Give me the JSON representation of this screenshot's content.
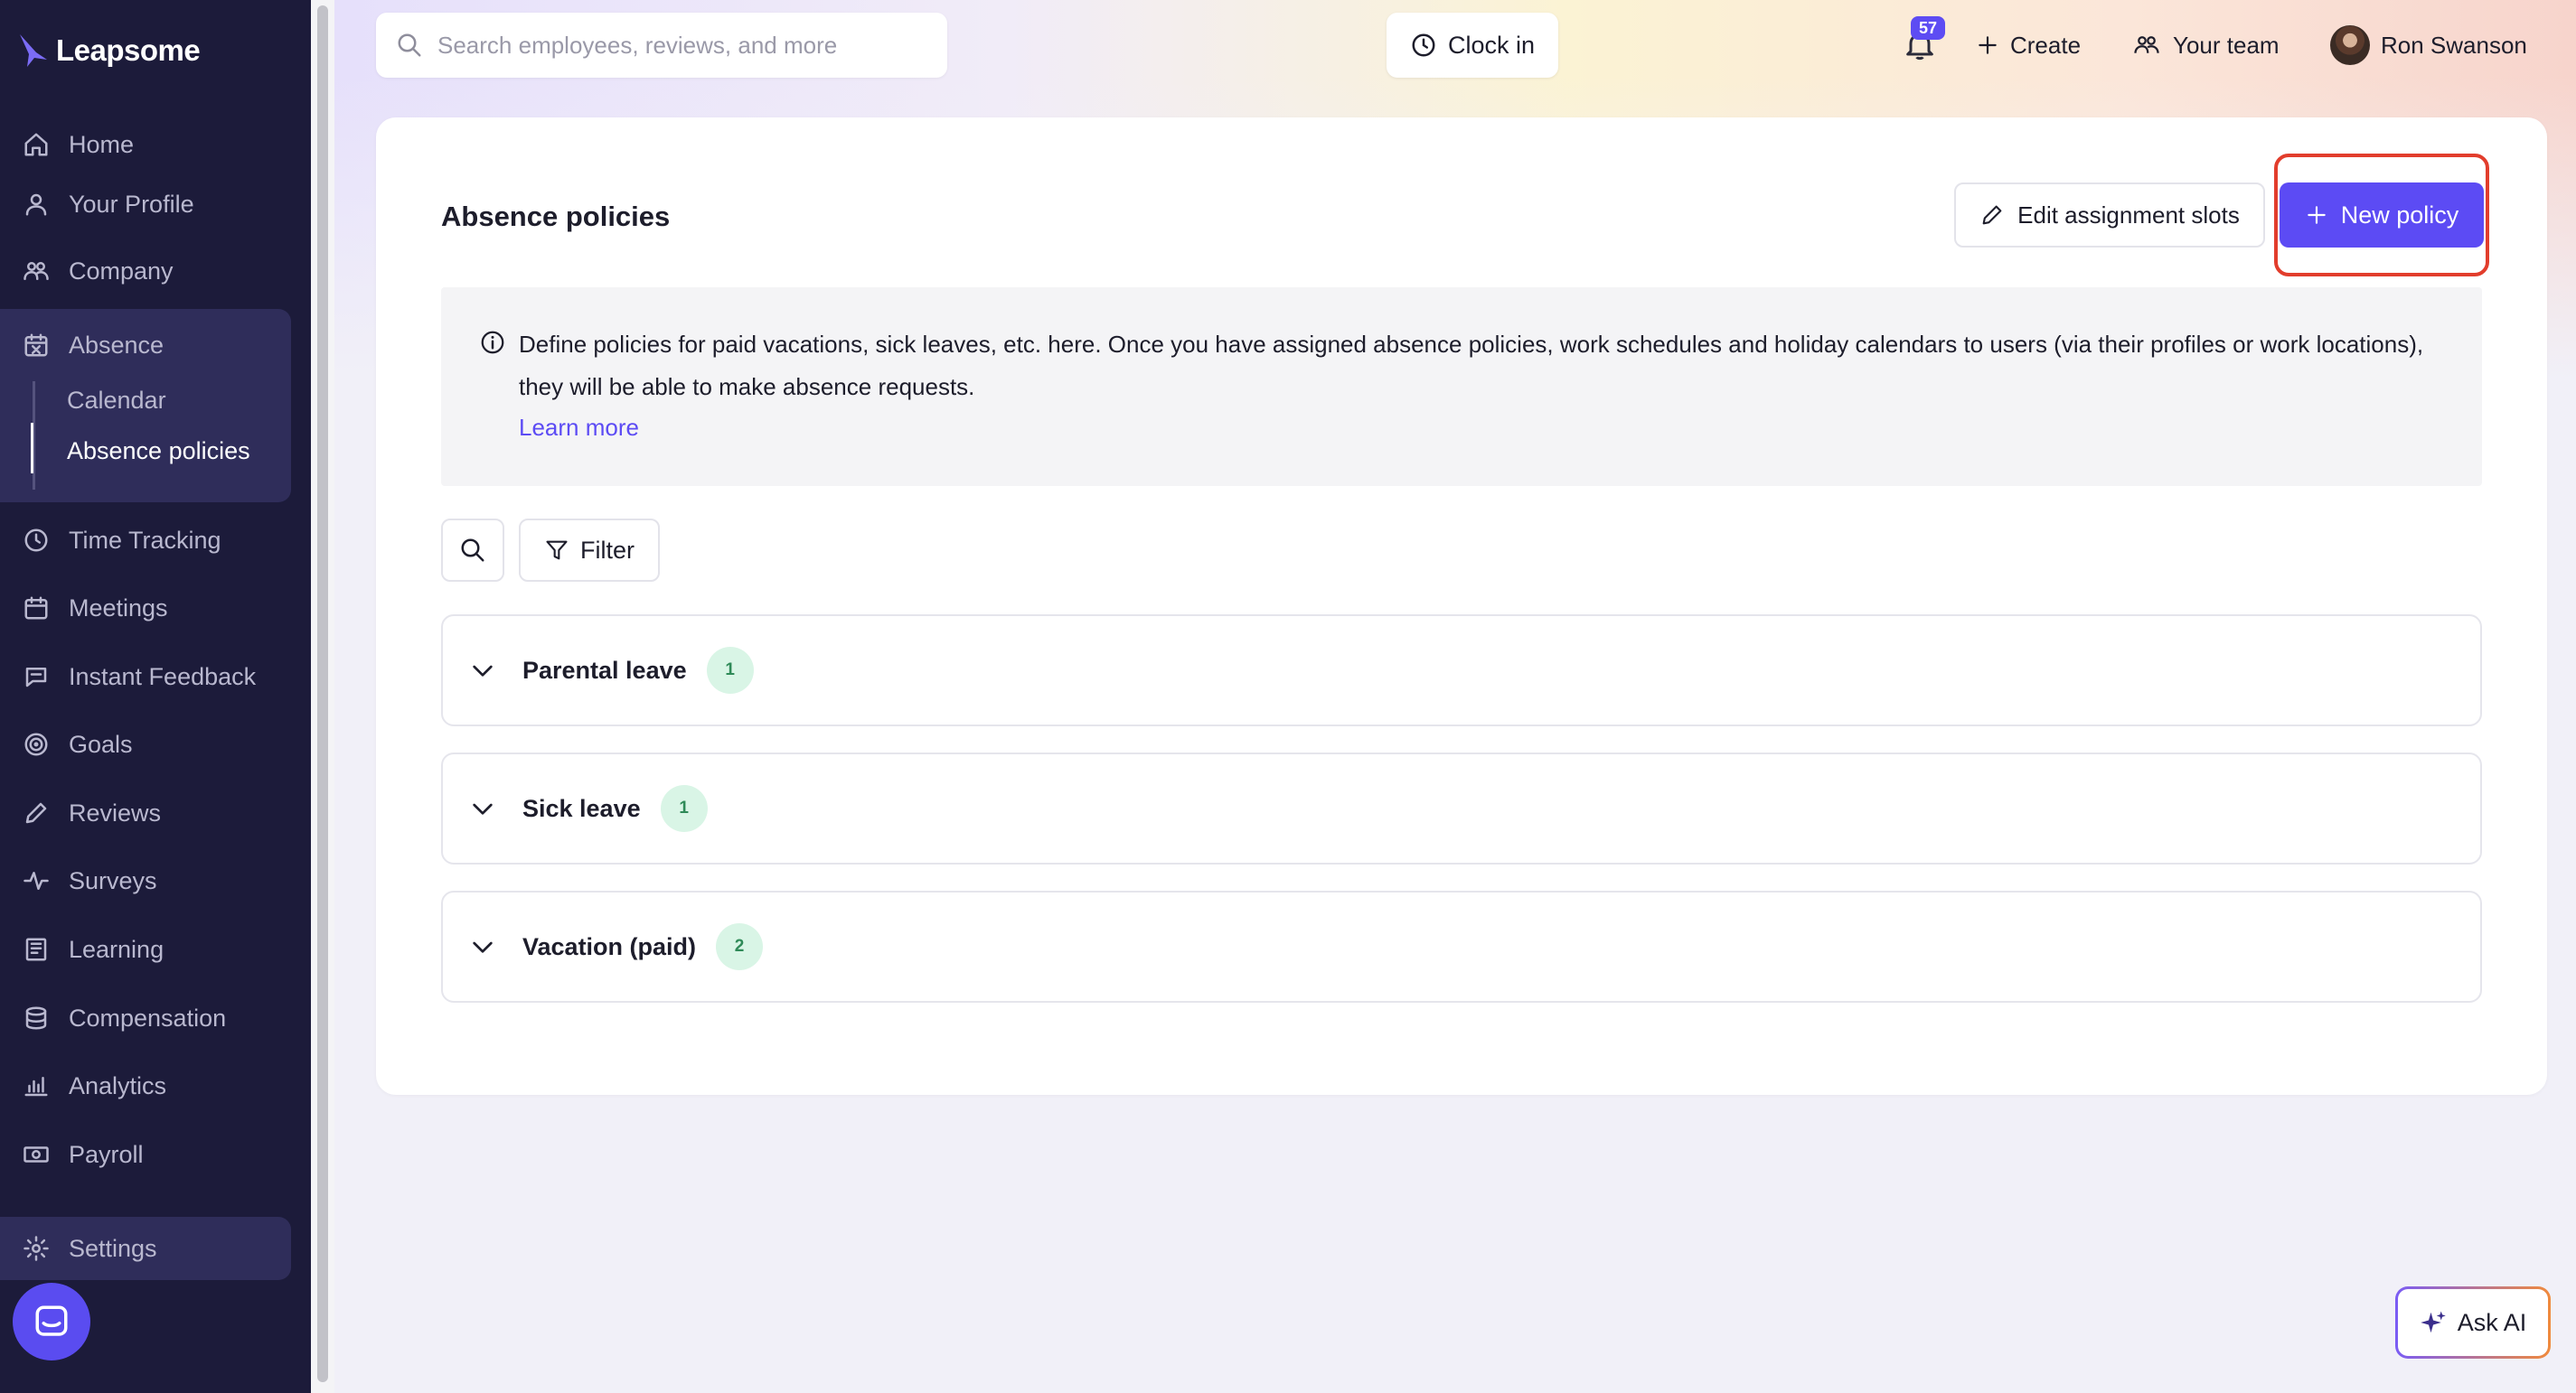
{
  "app": {
    "logo_text": "Leapsome"
  },
  "sidebar": {
    "items": [
      {
        "label": "Home",
        "icon": "home-icon"
      },
      {
        "label": "Your Profile",
        "icon": "user-icon"
      },
      {
        "label": "Company",
        "icon": "people-icon"
      },
      {
        "label": "Absence",
        "icon": "calendar-x-icon"
      },
      {
        "label": "Time Tracking",
        "icon": "clock-icon"
      },
      {
        "label": "Meetings",
        "icon": "calendar-icon"
      },
      {
        "label": "Instant Feedback",
        "icon": "chat-icon"
      },
      {
        "label": "Goals",
        "icon": "target-icon"
      },
      {
        "label": "Reviews",
        "icon": "pen-icon"
      },
      {
        "label": "Surveys",
        "icon": "pulse-icon"
      },
      {
        "label": "Learning",
        "icon": "book-icon"
      },
      {
        "label": "Compensation",
        "icon": "coins-icon"
      },
      {
        "label": "Analytics",
        "icon": "chart-icon"
      },
      {
        "label": "Payroll",
        "icon": "money-icon"
      }
    ],
    "absence_subitems": [
      {
        "label": "Calendar"
      },
      {
        "label": "Absence policies"
      }
    ],
    "settings_label": "Settings"
  },
  "header": {
    "search_placeholder": "Search employees, reviews, and more",
    "clock_in_label": "Clock in",
    "notifications_count": "57",
    "create_label": "Create",
    "your_team_label": "Your team",
    "user_name": "Ron Swanson"
  },
  "main": {
    "title": "Absence policies",
    "edit_button_label": "Edit assignment slots",
    "new_button_label": "New policy",
    "info_text": "Define policies for paid vacations, sick leaves, etc. here. Once you have assigned absence policies, work schedules and holiday calendars to users (via their profiles or work locations), they will be able to make absence requests.",
    "learn_more_label": "Learn more",
    "filter_label": "Filter",
    "policies": [
      {
        "name": "Parental leave",
        "count": "1"
      },
      {
        "name": "Sick leave",
        "count": "1"
      },
      {
        "name": "Vacation (paid)",
        "count": "2"
      }
    ]
  },
  "ask_ai_label": "Ask AI",
  "colors": {
    "sidebar_bg": "#1c1b3a",
    "accent": "#5c4bf4",
    "highlight": "#e23d2c",
    "badge_green": "#d9f5e6"
  }
}
